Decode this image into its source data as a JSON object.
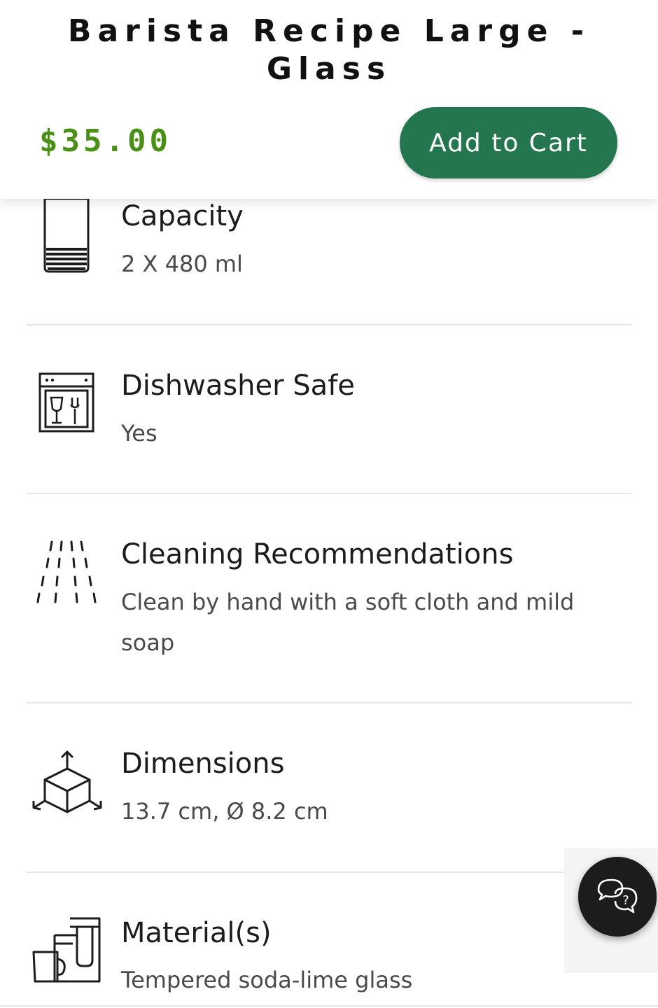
{
  "product": {
    "title": "Barista Recipe Large - Glass",
    "price": "$35.00",
    "add_to_cart_label": "Add to Cart"
  },
  "specs": [
    {
      "icon": "glass-icon",
      "label": "Capacity",
      "value": "2 X 480 ml"
    },
    {
      "icon": "dishwasher-icon",
      "label": "Dishwasher Safe",
      "value": "Yes"
    },
    {
      "icon": "water-spray-icon",
      "label": "Cleaning Recommendations",
      "value": "Clean by hand with a soft cloth and mild soap"
    },
    {
      "icon": "cube-dimensions-icon",
      "label": "Dimensions",
      "value": "13.7 cm, Ø 8.2 cm"
    },
    {
      "icon": "glassware-stack-icon",
      "label": "Material(s)",
      "value": "Tempered soda-lime glass"
    }
  ],
  "chat": {
    "icon": "chat-help-icon"
  },
  "colors": {
    "price": "#4a8f16",
    "button": "#24764f",
    "chat": "#1c1c1c"
  }
}
